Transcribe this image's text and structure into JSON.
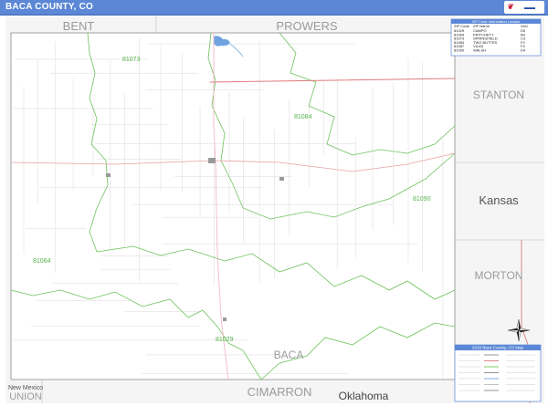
{
  "header": {
    "title": "BACA COUNTY, CO"
  },
  "neighbors": {
    "north_west": "BENT",
    "north_east": "PROWERS",
    "east_top": "STANTON",
    "east_state": "Kansas",
    "east_bottom": "MORTON",
    "south_west_state": "New Mexico",
    "south_west": "UNION",
    "south": "CIMARRON",
    "south_state": "Oklahoma",
    "county": "BACA"
  },
  "zip_labels": [
    {
      "code": "81073"
    },
    {
      "code": "81084"
    },
    {
      "code": "81090"
    },
    {
      "code": "81064"
    },
    {
      "code": "81029"
    }
  ],
  "zip_legend": {
    "header": "ZIP Code Information Locator",
    "columns": [
      "ZIP Code",
      "ZIP Name",
      "Grid"
    ],
    "rows": [
      [
        "81029",
        "CAMPO",
        "D5"
      ],
      [
        "81064",
        "PRITCHETT",
        "B4"
      ],
      [
        "81073",
        "SPRINGFIELD",
        "C3"
      ],
      [
        "81084",
        "TWO BUTTES",
        "F2"
      ],
      [
        "81087",
        "VILAS",
        "F4"
      ],
      [
        "81090",
        "WALSH",
        "D4"
      ]
    ]
  },
  "info_box": {
    "title": "2016 Baca County, CO Map"
  },
  "colors": {
    "title_bar": "#5b87d6",
    "zip_boundary": "#6cc25a",
    "road_major": "#e07a7a",
    "road_minor": "#c4c4c4",
    "water": "#6fa3e0",
    "frame": "#555555"
  },
  "icons": {
    "compass": "compass-rose-icon",
    "logo": "map-brand-logo"
  }
}
